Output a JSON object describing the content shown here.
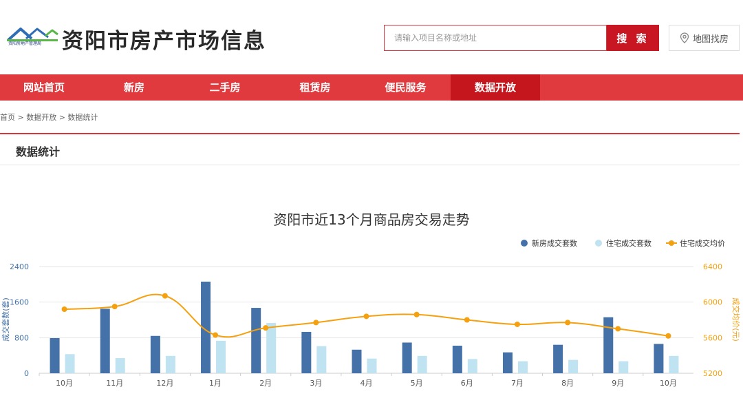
{
  "header": {
    "logo_caption": "资阳房地产管理局",
    "site_title": "资阳市房产市场信息",
    "search_placeholder": "请输入项目名称或地址",
    "search_label": "搜 索",
    "map_label": "地图找房"
  },
  "nav": {
    "items": [
      {
        "label": "网站首页"
      },
      {
        "label": "新房"
      },
      {
        "label": "二手房"
      },
      {
        "label": "租赁房"
      },
      {
        "label": "便民服务"
      },
      {
        "label": "数据开放"
      }
    ]
  },
  "breadcrumb": "首页 > 数据开放 > 数据统计",
  "panel_title": "数据统计",
  "colors": {
    "brand_red": "#e0393e",
    "active_red": "#c4161c",
    "new_house": "#4472a8",
    "resale": "#bfe3f0",
    "price": "#f5a00f"
  },
  "chart_data": {
    "type": "bar",
    "title": "资阳市近13个月商品房交易走势",
    "categories": [
      "10月",
      "11月",
      "12月",
      "1月",
      "2月",
      "3月",
      "4月",
      "5月",
      "6月",
      "7月",
      "8月",
      "9月",
      "10月"
    ],
    "series": [
      {
        "name": "新房成交套数",
        "type": "bar",
        "axis": "left",
        "color": "#4472a8",
        "values": [
          790,
          1450,
          840,
          2060,
          1470,
          930,
          530,
          690,
          620,
          470,
          640,
          1260,
          660
        ]
      },
      {
        "name": "住宅成交套数",
        "type": "bar",
        "axis": "left",
        "color": "#bfe3f0",
        "values": [
          430,
          340,
          390,
          730,
          1130,
          610,
          330,
          390,
          320,
          270,
          300,
          270,
          390
        ]
      },
      {
        "name": "住宅成交均价",
        "type": "line",
        "axis": "right",
        "color": "#f5a00f",
        "values": [
          5920,
          5950,
          6070,
          5630,
          5710,
          5770,
          5840,
          5860,
          5800,
          5750,
          5770,
          5700,
          5620
        ]
      }
    ],
    "ylabel": "成交套数(套)",
    "ylabel_right": "成交均价(元)",
    "ylim": [
      0,
      2400
    ],
    "ylim_right": [
      5200,
      6400
    ],
    "yticks": [
      0,
      800,
      1600,
      2400
    ],
    "yticks_right": [
      5200,
      5600,
      6000,
      6400
    ],
    "legend_position": "top-right",
    "grid": true
  }
}
